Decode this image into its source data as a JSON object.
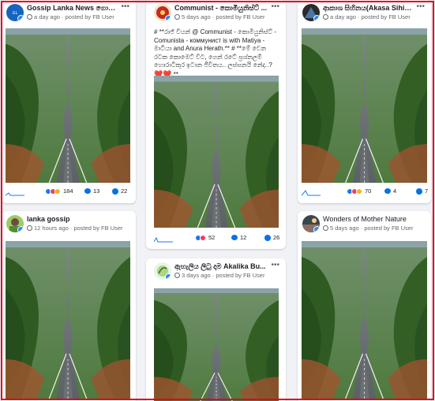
{
  "colors": {
    "accent": "#1877f2",
    "frame": "#e0001b",
    "link_blue": "#0572e6"
  },
  "posts": [
    {
      "page": "Gossip Lanka News ගොසිප්...",
      "meta": "a day ago · posted by FB User",
      "reactions": "184",
      "comments": "13",
      "shares": "22"
    },
    {
      "page": "Communist - කොමියුනිස්ට් ...",
      "meta": "5 days ago · posted by FB User",
      "text": "# **රාජ් වියන් @ Communist - කොමියුනිස්ට් - Comunista - коммунист is with Matiya - මාටියා and Anura Herath.** # **මේ වෙන රටක කොමෙට් විට, ගෙන් රටේ ප්‍රශ්නලම් හොරාටිකුර ඉටාන ජීවිතය.. ලස්සනයි නේද..? ",
      "text_hearts": "❤️❤️",
      "text_tail": " **",
      "reactions": "52",
      "comments": "12",
      "shares": "26"
    },
    {
      "page": "ආකාශ සිහිනය(Akasa Sihina...",
      "meta": "a day ago · posted by FB User",
      "reactions": "70",
      "comments": "4",
      "shares": "7"
    },
    {
      "page": "lanka gossip",
      "meta": "12 hours ago · posted by FB User"
    },
    {
      "page": "ඇහැලිය ලිටු දාම Akalika Bu...",
      "meta": "3 days ago · posted by FB User"
    },
    {
      "page": "Wonders of Mother Nature",
      "meta": "5 days ago · posted by FB User"
    }
  ],
  "icons": {
    "more": "more-dots-icon",
    "clock": "clock-icon",
    "comment": "comment-icon",
    "share": "share-icon",
    "sparkline": "sparkline-icon"
  },
  "more_label": "•••"
}
